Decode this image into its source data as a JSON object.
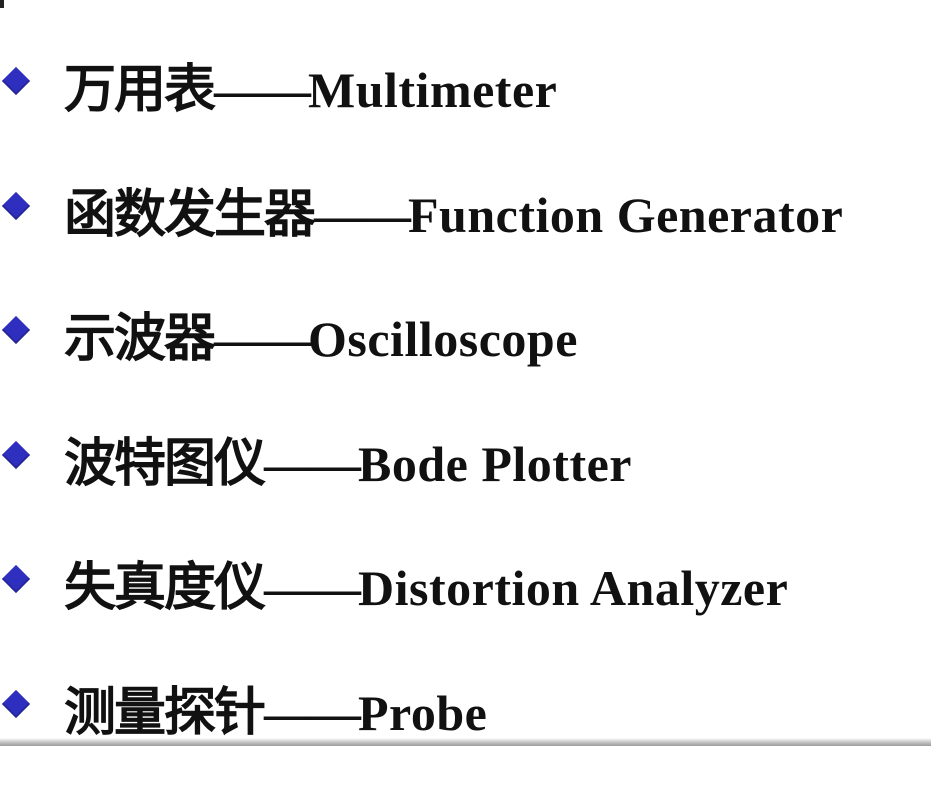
{
  "items": [
    {
      "zh": "万用表",
      "dash": "——",
      "en": "Multimeter"
    },
    {
      "zh": "函数发生器",
      "dash": "——",
      "en": "Function Generator"
    },
    {
      "zh": "示波器",
      "dash": "——",
      "en": "Oscilloscope"
    },
    {
      "zh": "波特图仪",
      "dash": "——",
      "en": "Bode Plotter"
    },
    {
      "zh": "失真度仪",
      "dash": "——",
      "en": "Distortion Analyzer"
    },
    {
      "zh": "测量探针",
      "dash": "——",
      "en": "Probe"
    }
  ],
  "colors": {
    "bullet": "#2f2fbf",
    "text": "#111111",
    "background": "#ffffff"
  },
  "icons": {
    "bullet": "diamond-bullet-icon"
  }
}
